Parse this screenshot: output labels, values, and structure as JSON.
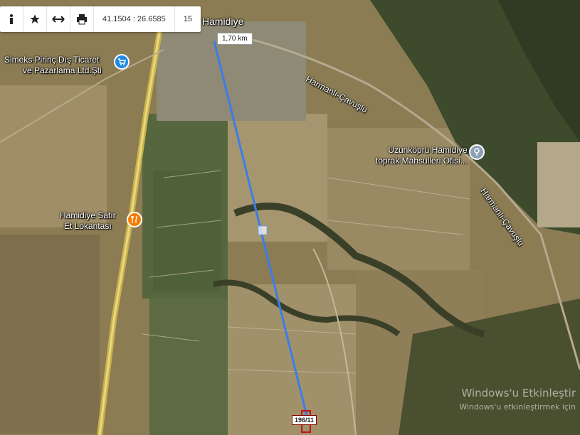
{
  "toolbar": {
    "coords": "41.1504 : 26.6585",
    "zoom": "15",
    "icons": [
      "info-icon",
      "star-icon",
      "measure-icon",
      "print-icon"
    ]
  },
  "measure": {
    "distance": "1,70 km"
  },
  "parcel": {
    "label": "196/11"
  },
  "places": {
    "village": "Hamidiye",
    "company_line1": "Simeks Pirinç Dış Ticaret",
    "company_line2": "ve Pazarlama Ltd.Şti",
    "restaurant_line1": "Hamidiye Satır",
    "restaurant_line2": "Et Lokantası",
    "office_line1": "Uzunköprü Hamidiye",
    "office_line2": "toprak Mahsulleri Ofisi...",
    "road1": "Harmanlı-Çavuşlu",
    "road2": "Harmanlı-Çavuşlu"
  },
  "os_watermark": {
    "line1": "Windows'u Etkinleştir",
    "line2": "Windows'u etkinleştirmek için"
  },
  "colors": {
    "measure_line": "#3b7de6",
    "poi_blue": "#1e88e5",
    "poi_orange": "#f57c00",
    "poi_gray": "#8aa0b4"
  }
}
